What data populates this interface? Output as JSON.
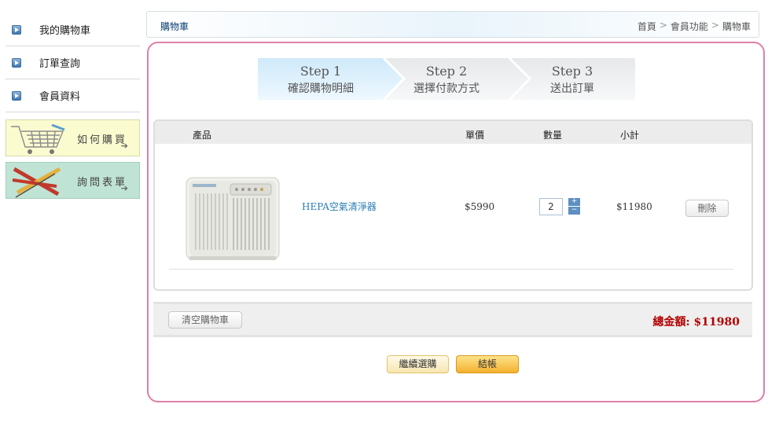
{
  "sidebar": {
    "items": [
      {
        "label": "我的購物車"
      },
      {
        "label": "訂單查詢"
      },
      {
        "label": "會員資料"
      }
    ],
    "banners": {
      "howto": "如何購買",
      "survey": "詢問表單"
    }
  },
  "header": {
    "title": "購物車",
    "breadcrumb": [
      "首頁",
      "會員功能",
      "購物車"
    ],
    "separator": ">"
  },
  "steps": [
    {
      "step": "Step 1",
      "label": "確認購物明細",
      "active": true
    },
    {
      "step": "Step 2",
      "label": "選擇付款方式",
      "active": false
    },
    {
      "step": "Step 3",
      "label": "送出訂單",
      "active": false
    }
  ],
  "cart": {
    "columns": {
      "product": "產品",
      "price": "單價",
      "quantity": "數量",
      "subtotal": "小計"
    },
    "items": [
      {
        "name": "HEPA空氣清淨器",
        "price": "$5990",
        "quantity": "2",
        "subtotal": "$11980",
        "delete_label": "刪除",
        "image_icon": "air-purifier"
      }
    ],
    "plus": "+",
    "minus": "−",
    "clear_label": "清空購物車",
    "total_label": "總金額:",
    "total_value": "$11980"
  },
  "actions": {
    "continue_label": "繼續選購",
    "checkout_label": "結帳"
  },
  "colors": {
    "frame": "#e07fa8",
    "active_step": "#d4ecfa",
    "total": "#b30000",
    "link": "#2a7fb6"
  }
}
